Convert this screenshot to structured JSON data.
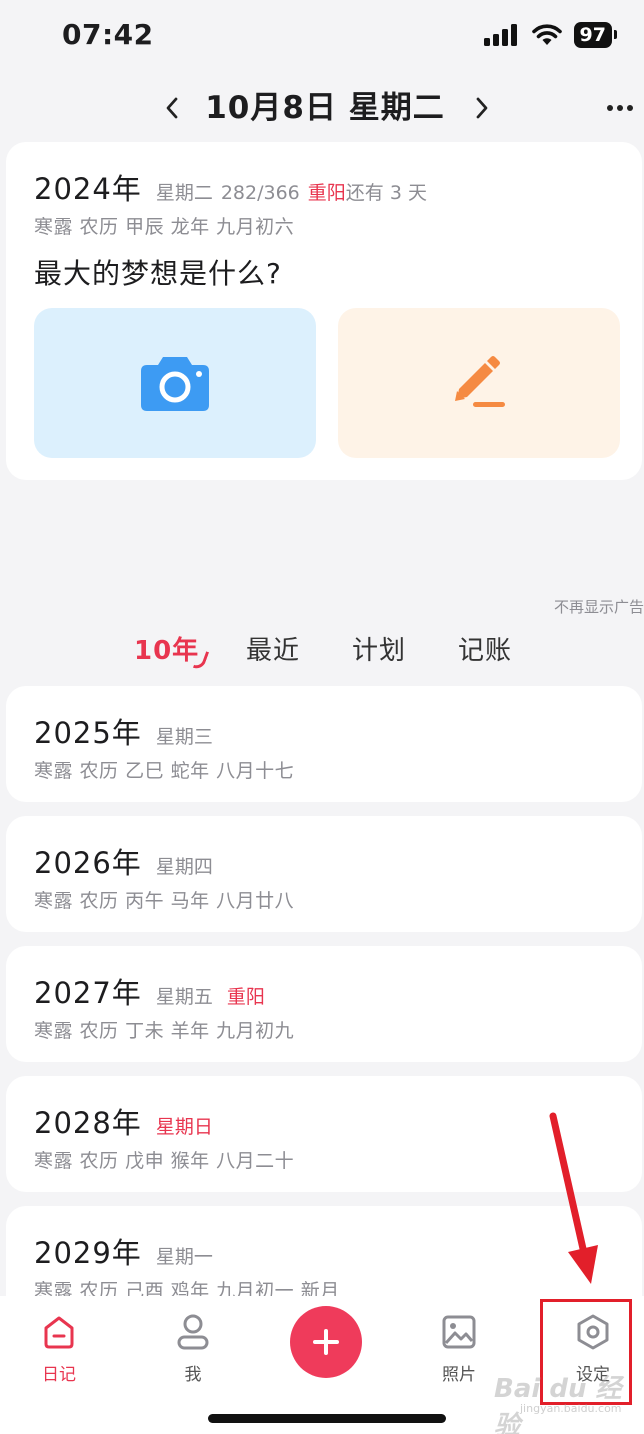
{
  "status_bar": {
    "time": "07:42",
    "battery": "97"
  },
  "header": {
    "title": "10月8日 星期二"
  },
  "today": {
    "year": "2024年",
    "weekday": "星期二",
    "day_count": "282/366",
    "festival": "重阳",
    "festival_suffix": "还有 3 天",
    "lunar": "寒露  农历  甲辰  龙年  九月初六",
    "question": "最大的梦想是什么?"
  },
  "ad_dismiss": "不再显示广告",
  "tabs": [
    {
      "label": "10年"
    },
    {
      "label": "最近"
    },
    {
      "label": "计划"
    },
    {
      "label": "记账"
    }
  ],
  "years": [
    {
      "year": "2025年",
      "weekday": "星期三",
      "festival": "",
      "lunar": "寒露  农历  乙巳  蛇年  八月十七"
    },
    {
      "year": "2026年",
      "weekday": "星期四",
      "festival": "",
      "lunar": "寒露  农历  丙午  马年  八月廿八"
    },
    {
      "year": "2027年",
      "weekday": "星期五",
      "festival": "重阳",
      "lunar": "寒露  农历  丁未  羊年  九月初九"
    },
    {
      "year": "2028年",
      "weekday": "星期日",
      "festival": "",
      "lunar": "寒露  农历  戊申  猴年  八月二十"
    },
    {
      "year": "2029年",
      "weekday": "星期一",
      "festival": "",
      "lunar": "寒露  农历  己酉  鸡年  九月初一  新月"
    }
  ],
  "bottom_nav": {
    "diary": "日记",
    "me": "我",
    "photos": "照片",
    "settings": "设定"
  },
  "watermark": {
    "brand": "Bai du 经验",
    "url": "jingyan.baidu.com"
  },
  "colors": {
    "accent": "#e8354f",
    "annotation": "#e21f2a"
  }
}
